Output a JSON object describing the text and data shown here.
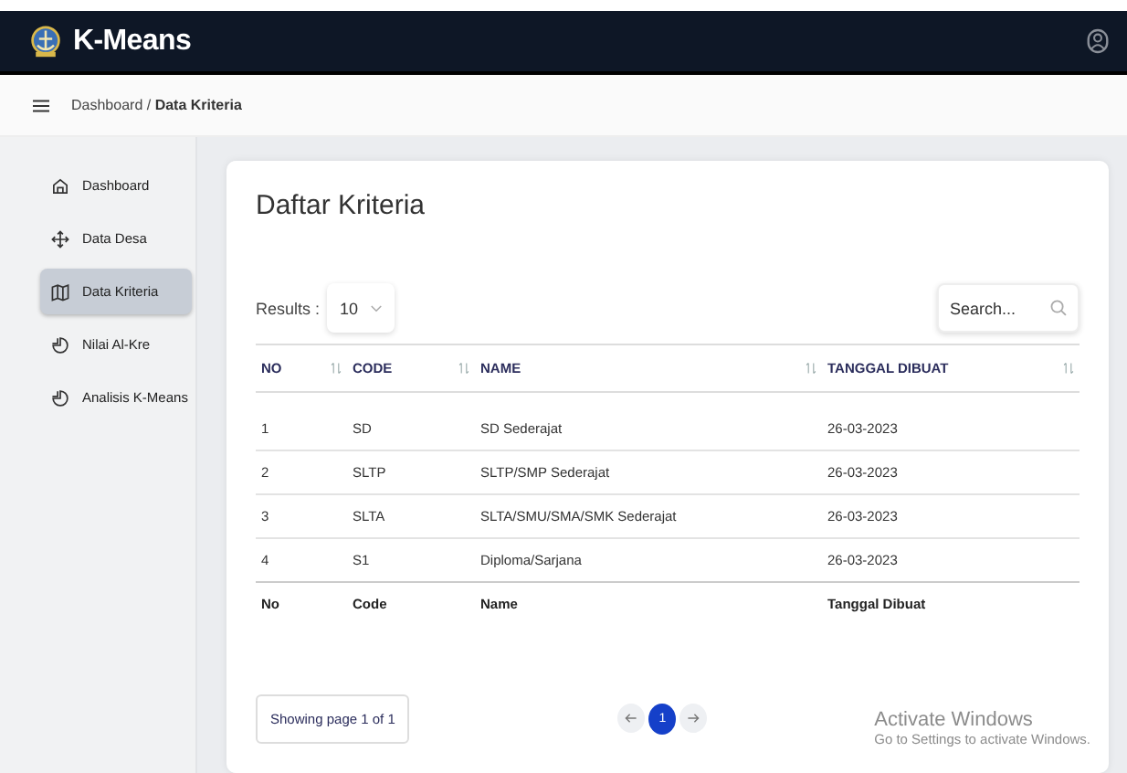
{
  "app": {
    "title": "K-Means"
  },
  "breadcrumb": {
    "path": "Dashboard / **Data Kriteria**"
  },
  "sidebar": {
    "items": [
      {
        "label": "Dashboard",
        "kind": "home",
        "selected": false
      },
      {
        "label": "Data Desa",
        "kind": "move",
        "selected": false
      },
      {
        "label": "Data Kriteria",
        "kind": "map",
        "selected": true
      },
      {
        "label": "Nilai Al-Kre",
        "kind": "pie",
        "selected": false
      },
      {
        "label": "Analisis K-Means",
        "kind": "pie",
        "selected": false
      }
    ]
  },
  "card": {
    "title": "Daftar Kriteria",
    "results_label": "Results :",
    "page_size": "10",
    "search": {
      "placeholder": "Search..."
    },
    "table": {
      "columns": [
        "NO",
        "CODE",
        "NAME",
        "TANGGAL DIBUAT"
      ],
      "rows": [
        [
          "1",
          "SD",
          "SD Sederajat",
          "26-03-2023"
        ],
        [
          "2",
          "SLTP",
          "SLTP/SMP Sederajat",
          "26-03-2023"
        ],
        [
          "3",
          "SLTA",
          "SLTA/SMU/SMA/SMK Sederajat",
          "26-03-2023"
        ],
        [
          "4",
          "S1",
          "Diploma/Sarjana",
          "26-03-2023"
        ]
      ],
      "footer": [
        "No",
        "Code",
        "Name",
        "Tanggal Dibuat"
      ]
    },
    "page_info": "Showing page 1 of 1",
    "pages": [
      {
        "label": "1",
        "selected": true
      }
    ]
  },
  "os_overlay": {
    "title": "Activate Windows",
    "subtitle": "Go to Settings to activate Windows."
  }
}
